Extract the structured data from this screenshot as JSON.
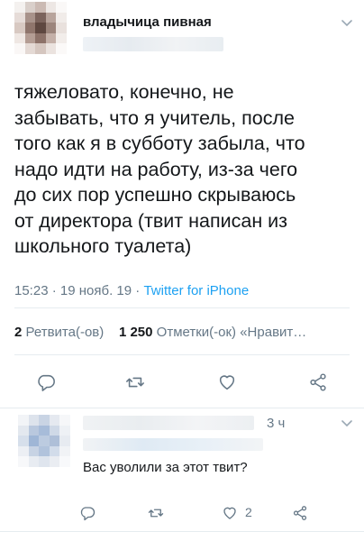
{
  "tweet": {
    "author_name": "владычица пивная",
    "text": "тяжеловато, конечно, не\nзабывать, что я учитель, после\nтого как я в субботу забыла, что\nнадо идти на работу, из-за чего\nдо сих пор успешно скрываюсь\nот директора (твит написан из\nшкольного туалета)",
    "time": "15:23",
    "sep1": " · ",
    "date": "19 нояб. 19",
    "sep2": " · ",
    "source": "Twitter for iPhone"
  },
  "stats": {
    "retweets_count": "2",
    "retweets_label": "Ретвита(-ов)",
    "likes_count": "1 250",
    "likes_label": "Отметки(-ок) «Нравит…"
  },
  "actions": [
    "reply-icon",
    "retweet-icon",
    "like-icon",
    "share-icon"
  ],
  "reply": {
    "time": "3 ч",
    "text": "Вас уволили за этот твит?",
    "like_count": "2"
  },
  "colors": {
    "accent": "#1da1f2",
    "secondary_text": "#657786",
    "divider": "#e6ecf0"
  }
}
